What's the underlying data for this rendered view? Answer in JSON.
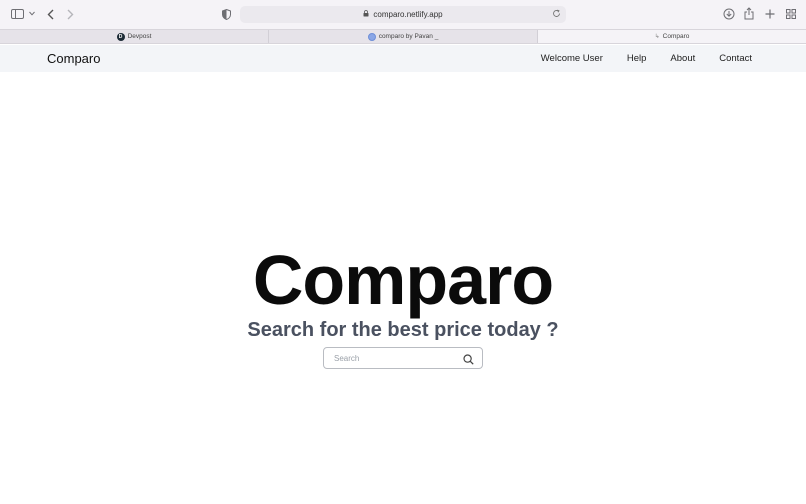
{
  "browser": {
    "url": "comparo.netlify.app",
    "tabs": [
      {
        "label": "Devpost",
        "active": false
      },
      {
        "label": "comparo by Pavan _",
        "active": false
      },
      {
        "label": "Comparo",
        "active": true
      }
    ]
  },
  "site": {
    "brand": "Comparo",
    "nav": [
      "Welcome User",
      "Help",
      "About",
      "Contact"
    ]
  },
  "hero": {
    "title": "Comparo",
    "subtitle": "Search for the best price today ?",
    "search_placeholder": "Search"
  }
}
